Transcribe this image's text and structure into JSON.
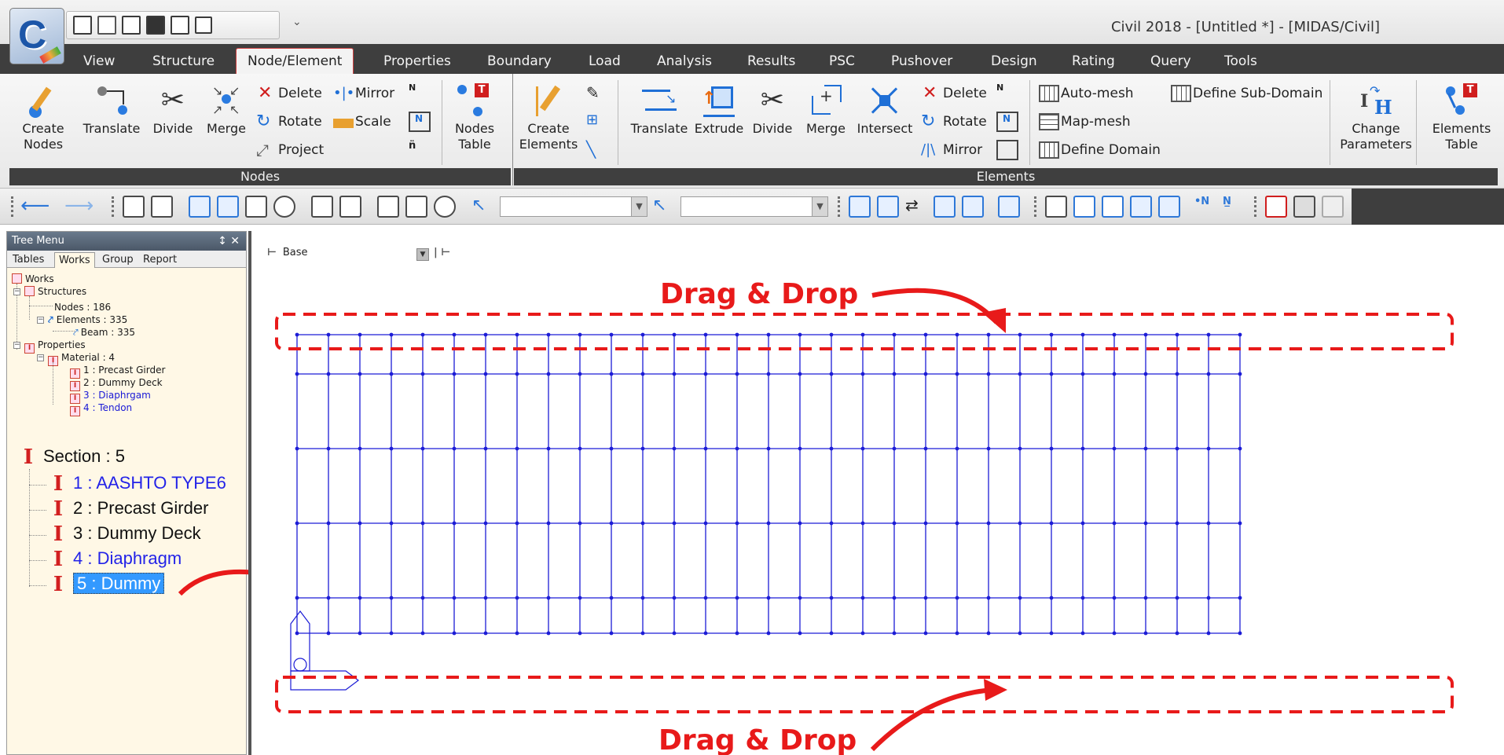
{
  "window": {
    "title": "Civil 2018 - [Untitled *] - [MIDAS/Civil]",
    "logo_letter": "C",
    "qat_dropdown": "⌄"
  },
  "tabs": [
    {
      "label": "View"
    },
    {
      "label": "Structure"
    },
    {
      "label": "Node/Element",
      "active": true
    },
    {
      "label": "Properties"
    },
    {
      "label": "Boundary"
    },
    {
      "label": "Load"
    },
    {
      "label": "Analysis"
    },
    {
      "label": "Results"
    },
    {
      "label": "PSC"
    },
    {
      "label": "Pushover"
    },
    {
      "label": "Design"
    },
    {
      "label": "Rating"
    },
    {
      "label": "Query"
    },
    {
      "label": "Tools"
    }
  ],
  "ribbon": {
    "nodes": {
      "group_label": "Nodes",
      "create_l1": "Create",
      "create_l2": "Nodes",
      "translate": "Translate",
      "divide": "Divide",
      "merge": "Merge",
      "delete": "Delete",
      "rotate": "Rotate",
      "project": "Project",
      "mirror": "Mirror",
      "scale": "Scale",
      "table_l1": "Nodes",
      "table_l2": "Table"
    },
    "elements": {
      "group_label": "Elements",
      "create_l1": "Create",
      "create_l2": "Elements",
      "translate": "Translate",
      "extrude": "Extrude",
      "divide": "Divide",
      "merge": "Merge",
      "intersect": "Intersect",
      "delete": "Delete",
      "rotate": "Rotate",
      "mirror": "Mirror",
      "auto_mesh": "Auto-mesh",
      "map_mesh": "Map-mesh",
      "define_domain": "Define Domain",
      "define_subdomain": "Define Sub-Domain",
      "change_l1": "Change",
      "change_l2": "Parameters",
      "table_l1": "Elements",
      "table_l2": "Table"
    }
  },
  "tree": {
    "title": "Tree Menu",
    "controls": "↕ ✕",
    "tabs": [
      "Tables",
      "Works",
      "Group",
      "Report"
    ],
    "active_tab": "Works",
    "works": "Works",
    "structures": "Structures",
    "nodes": "Nodes : 186",
    "elements": "Elements : 335",
    "beam": "Beam : 335",
    "properties": "Properties",
    "material": "Material : 4",
    "materials": [
      "1 : Precast Girder",
      "2 : Dummy Deck",
      "3 : Diaphrgam",
      "4 : Tendon"
    ],
    "section": "Section : 5",
    "sections": [
      "1 : AASHTO TYPE6",
      "2 : Precast Girder",
      "3 : Dummy Deck",
      "4 : Diaphragm",
      "5 : Dummy"
    ]
  },
  "model_view": {
    "story_label": "Base",
    "grid_columns": [
      0,
      40,
      80,
      120,
      160,
      200,
      240,
      280,
      320,
      360,
      400,
      440,
      480,
      520,
      560,
      600,
      640,
      680,
      720,
      760,
      800,
      840,
      880,
      920,
      960,
      1000,
      1040,
      1080,
      1120,
      1160,
      1200
    ],
    "grid_rows": [
      0,
      50,
      145,
      240,
      335,
      380
    ],
    "mesh_color": "#1c1cd6",
    "callout_color": "#e81a1a",
    "callout_top": "Drag & Drop",
    "callout_bottom": "Drag & Drop"
  }
}
